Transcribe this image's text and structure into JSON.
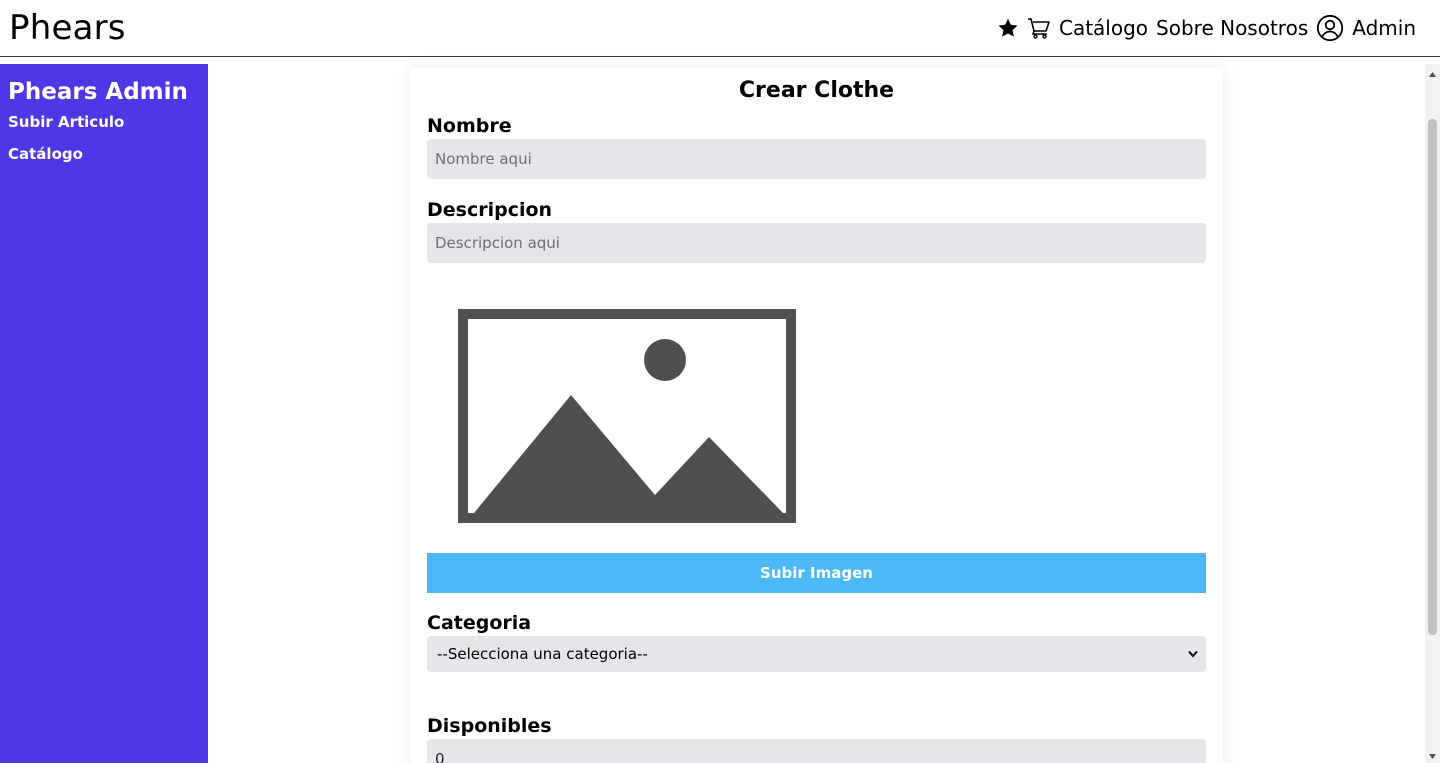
{
  "navbar": {
    "brand": "Phears",
    "links": {
      "catalog": "Catálogo",
      "about": "Sobre Nosotros",
      "admin": "Admin"
    }
  },
  "sidebar": {
    "title": "Phears Admin",
    "items": [
      {
        "label": "Subir Articulo"
      },
      {
        "label": "Catálogo"
      }
    ]
  },
  "form": {
    "title": "Crear Clothe",
    "nombre": {
      "label": "Nombre",
      "placeholder": "Nombre aqui"
    },
    "descripcion": {
      "label": "Descripcion",
      "placeholder": "Descripcion aqui"
    },
    "upload_button": "Subir Imagen",
    "categoria": {
      "label": "Categoria",
      "selected": "--Selecciona una categoria--"
    },
    "disponibles": {
      "label": "Disponibles",
      "value": "0"
    }
  },
  "colors": {
    "sidebar_bg": "#4f37e8",
    "upload_button_bg": "#4bb9f7",
    "input_bg": "#e5e6ea",
    "placeholder_image_gray": "#4f4f4f"
  },
  "icons": [
    "star-icon",
    "cart-icon",
    "user-circle-icon",
    "image-placeholder-icon",
    "chevron-down-icon"
  ]
}
